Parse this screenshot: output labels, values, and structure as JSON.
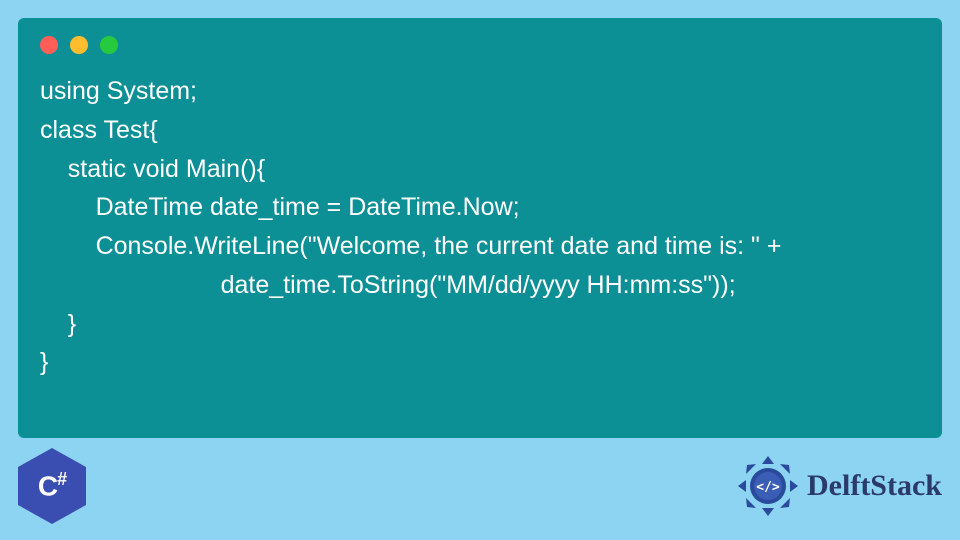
{
  "code": {
    "line1": "using System;",
    "line2": "class Test{",
    "line3": "    static void Main(){",
    "line4": "        DateTime date_time = DateTime.Now;",
    "line5": "        Console.WriteLine(\"Welcome, the current date and time is: \" +",
    "line6": "                          date_time.ToString(\"MM/dd/yyyy HH:mm:ss\"));",
    "line7": "    }",
    "line8": "}"
  },
  "badge": {
    "lang_c": "C",
    "lang_hash": "#"
  },
  "brand": {
    "name": "DelftStack"
  }
}
